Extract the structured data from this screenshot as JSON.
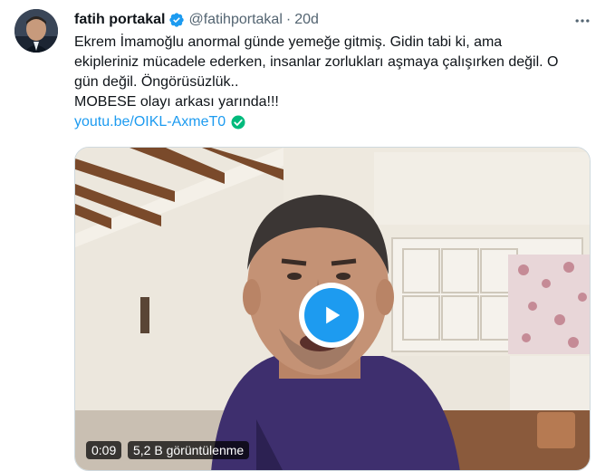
{
  "author": {
    "display_name": "fatih portakal",
    "handle": "@fatihportakal",
    "separator": "·",
    "timestamp": "20d"
  },
  "tweet": {
    "lines": [
      "Ekrem İmamoğlu anormal günde yemeğe gitmiş. Gidin tabi ki, ama",
      "ekipleriniz mücadele ederken, insanlar zorlukları aşmaya çalışırken değil. O",
      "gün değil. Öngörüsüzlük..",
      "MOBESE olayı arkası yarında!!!"
    ],
    "link": "youtu.be/OIKL-AxmeT0"
  },
  "video": {
    "duration": "0:09",
    "views": "5,2 B görüntülenme"
  },
  "colors": {
    "accent": "#1d9bf0",
    "verified_check": "#00ba7c",
    "muted_text": "#536471"
  },
  "icons": {
    "verified": "verified-badge-icon",
    "more": "more-horizontal-icon",
    "play": "play-icon",
    "link_check": "check-circle-icon"
  }
}
